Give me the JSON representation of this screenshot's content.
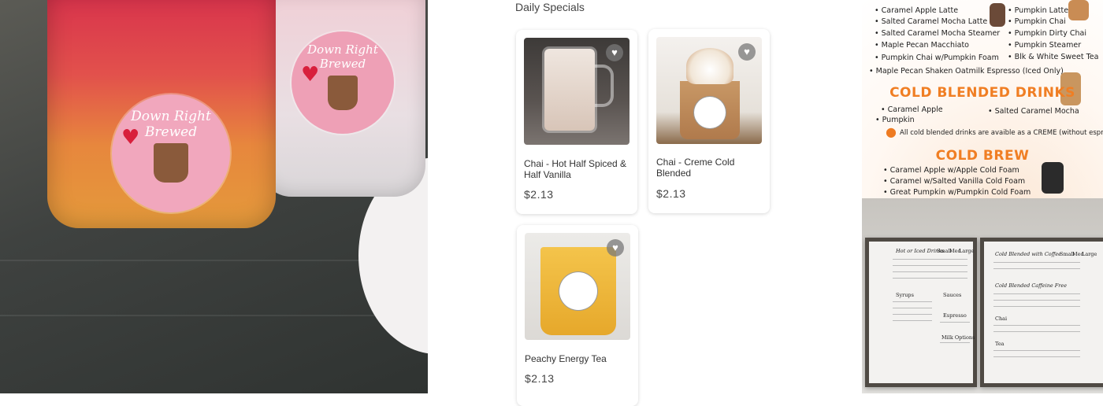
{
  "left_photo": {
    "sticker_text_front": "Down Right Brewed",
    "sticker_text_back": "Down Right Brewed"
  },
  "specials": {
    "section_title": "Daily Specials",
    "items": [
      {
        "name": "Chai - Hot Half Spiced & Half Vanilla",
        "price": "$2.13",
        "favorite_icon": "heart-icon"
      },
      {
        "name": "Chai - Creme Cold Blended",
        "price": "$2.13",
        "favorite_icon": "heart-icon"
      },
      {
        "name": "Peachy Energy Tea",
        "price": "$2.13",
        "favorite_icon": "heart-icon"
      }
    ]
  },
  "menu_orange": {
    "left_items": [
      "Caramel Apple Latte",
      "Salted Caramel Mocha Latte",
      "Salted Caramel Mocha Steamer",
      "Maple Pecan Macchiato",
      "Pumpkin Chai w/Pumpkin Foam",
      "Maple Pecan Shaken Oatmilk Espresso (Iced Only)"
    ],
    "right_items": [
      "Pumpkin Latte",
      "Pumpkin Chai",
      "Pumpkin Dirty Chai",
      "Pumpkin Steamer",
      "Blk & White Sweet Tea"
    ],
    "cold_blended_heading": "COLD BLENDED DRINKS",
    "cold_blended_items": [
      "Caramel Apple",
      "Pumpkin",
      "Salted Caramel Mocha"
    ],
    "cold_blended_note": "All cold blended drinks are avaible as a CREME (without espresso)",
    "cold_brew_heading": "COLD BREW",
    "cold_brew_items": [
      "Caramel Apple w/Apple Cold Foam",
      "Caramel w/Salted Vanilla Cold Foam",
      "Great Pumpkin w/Pumpkin Cold Foam"
    ],
    "accent_color": "#f07e23"
  },
  "menu_board": {
    "left_board_title": "Hot or Iced Drinks",
    "left_board_sections": [
      "Syrups",
      "Sauces",
      "Espresso",
      "Milk Options"
    ],
    "right_board_title": "Cold Blended with Coffee",
    "right_board_sections": [
      "Cold Blended Caffeine Free",
      "Chai",
      "Tea"
    ],
    "size_headers": [
      "Small",
      "Med",
      "Large"
    ]
  }
}
